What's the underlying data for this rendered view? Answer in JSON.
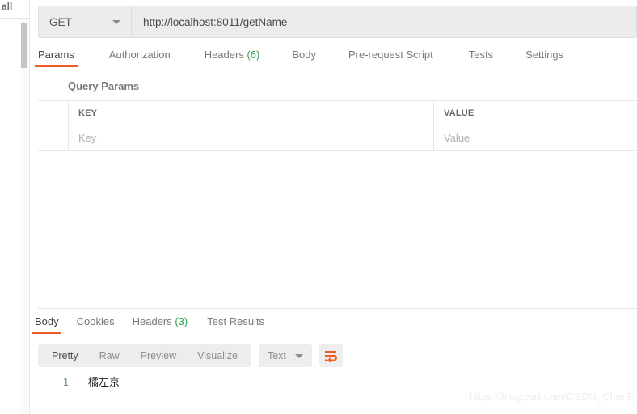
{
  "left_strip": {
    "label": "all"
  },
  "request": {
    "method": "GET",
    "url": "http://localhost:8011/getName",
    "tabs": [
      {
        "label": "Params",
        "count": "",
        "active": true
      },
      {
        "label": "Authorization",
        "count": "",
        "active": false
      },
      {
        "label": "Headers",
        "count": "(6)",
        "active": false
      },
      {
        "label": "Body",
        "count": "",
        "active": false
      },
      {
        "label": "Pre-request Script",
        "count": "",
        "active": false
      },
      {
        "label": "Tests",
        "count": "",
        "active": false
      },
      {
        "label": "Settings",
        "count": "",
        "active": false
      }
    ],
    "query_params_label": "Query Params",
    "table": {
      "headers": [
        "KEY",
        "VALUE"
      ],
      "placeholder_row": [
        "Key",
        "Value"
      ]
    }
  },
  "response": {
    "tabs": [
      {
        "label": "Body",
        "count": "",
        "active": true
      },
      {
        "label": "Cookies",
        "count": "",
        "active": false
      },
      {
        "label": "Headers",
        "count": "(3)",
        "active": false
      },
      {
        "label": "Test Results",
        "count": "",
        "active": false
      }
    ],
    "format_buttons": [
      {
        "label": "Pretty",
        "active": true
      },
      {
        "label": "Raw",
        "active": false
      },
      {
        "label": "Preview",
        "active": false
      },
      {
        "label": "Visualize",
        "active": false
      }
    ],
    "type_selector": "Text",
    "body_lines": [
      {
        "number": "1",
        "content": "橘左京"
      }
    ]
  },
  "watermark": "https://blog.csdn.net/CSDN_ChenF",
  "colors": {
    "accent": "#ef5b25",
    "count_green": "#30a14e",
    "line_number": "#5c8a9e",
    "toolbar_bg": "#ededed",
    "field_bg": "#ececec"
  }
}
